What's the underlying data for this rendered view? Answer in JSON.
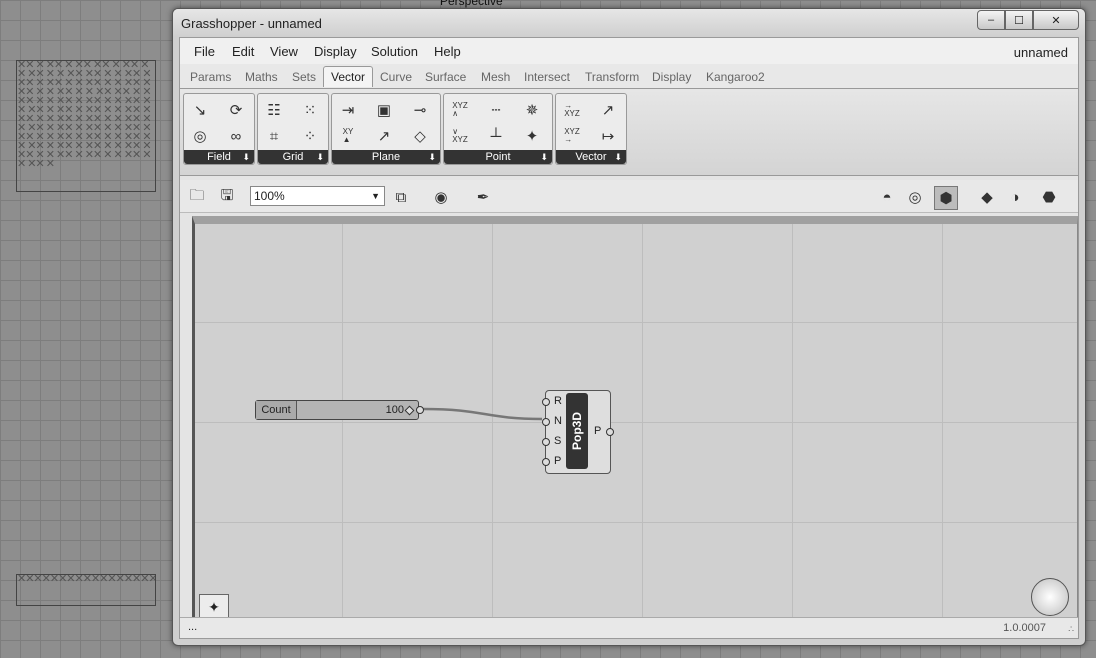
{
  "rhino": {
    "viewport_label": "Perspective"
  },
  "window": {
    "title": "Grasshopper - unnamed",
    "minimize": "–",
    "maximize": "☐",
    "close": "✕"
  },
  "menu": {
    "items": [
      "File",
      "Edit",
      "View",
      "Display",
      "Solution",
      "Help"
    ],
    "document_name": "unnamed"
  },
  "tabs": {
    "items": [
      "Params",
      "Maths",
      "Sets",
      "Vector",
      "Curve",
      "Surface",
      "Mesh",
      "Intersect",
      "Transform",
      "Display",
      "Kangaroo2"
    ],
    "active": "Vector"
  },
  "ribbon": {
    "groups": [
      "Field",
      "Grid",
      "Plane",
      "Point",
      "Vector"
    ]
  },
  "toolbar": {
    "zoom": "100%"
  },
  "canvas": {
    "slider": {
      "label": "Count",
      "value": "100"
    },
    "component": {
      "name": "Pop3D",
      "inputs": [
        "R",
        "N",
        "S",
        "P"
      ],
      "output": "P"
    }
  },
  "status": {
    "text": "...",
    "version": "1.0.0007"
  }
}
